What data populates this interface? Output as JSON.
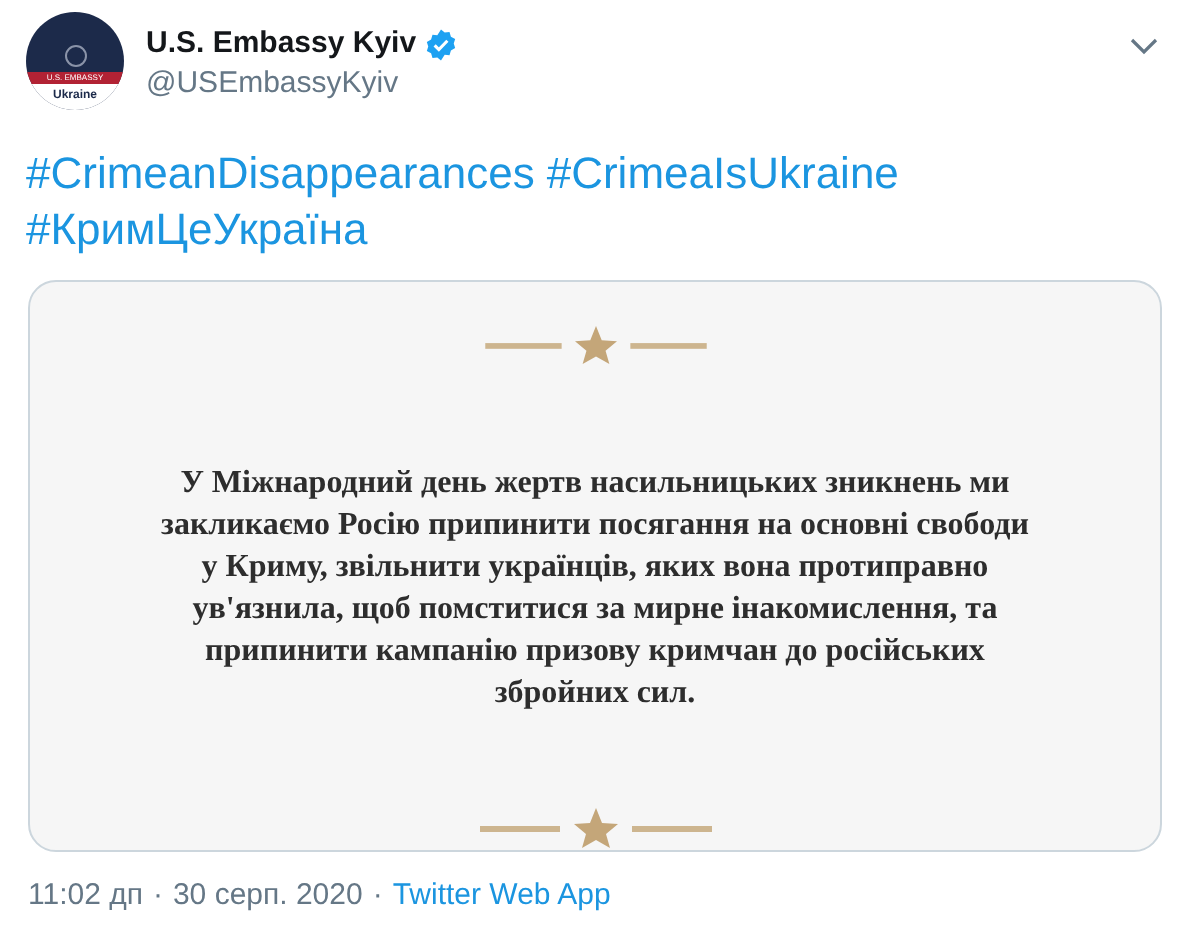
{
  "author": {
    "name": "U.S. Embassy Kyiv",
    "verified": true,
    "handle": "@USEmbassyKyiv",
    "avatar_band": "U.S. EMBASSY",
    "avatar_label": "Ukraine"
  },
  "hashtags": [
    "#CrimeanDisappearances",
    "#CrimeaIsUkraine",
    "#КримЦеУкраїна"
  ],
  "card": {
    "lines": [
      "У Міжнародний день жертв насильницьких зникнень ми",
      "закликаємо Росію припинити посягання на основні свободи",
      "у Криму, звільнити українців, яких вона протиправно",
      "ув'язнила, щоб помститися за мирне інакомислення, та",
      "припинити кампанію призову кримчан до російських",
      "збройних сил."
    ]
  },
  "footer": {
    "time": "11:02 дп",
    "separator_1": "·",
    "date": "30 серп. 2020",
    "separator_2": "·",
    "source": "Twitter Web App"
  }
}
